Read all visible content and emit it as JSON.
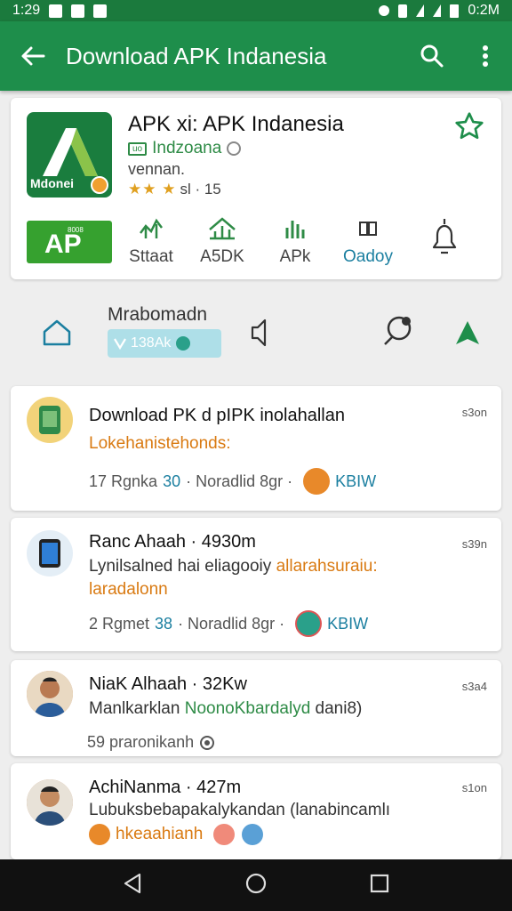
{
  "status_bar": {
    "time": "1:29",
    "clock": "0:2M"
  },
  "app_bar": {
    "title": "Download APK Indanesia"
  },
  "app_card": {
    "logo_text": "Mdonei",
    "name": "APK xi: APK Indanesia",
    "developer_badge": "uo",
    "developer": "Indzoana",
    "version": "vennan.",
    "stars": "★★ ★",
    "rating_text": "sl · 15",
    "ap_button_small": "8008",
    "ap_button_big": "AP",
    "features": [
      {
        "label": "Sttaat"
      },
      {
        "label": "A5DK"
      },
      {
        "label": "APk"
      },
      {
        "label": "Oadoy"
      }
    ]
  },
  "action_row": {
    "title": "Mrabomadn",
    "size_chip": "138Ak"
  },
  "posts": [
    {
      "title": "Download PK d pIPK inolahallan",
      "time": "s3on",
      "line1": "Lokehanistehonds:",
      "meta_pre": "17 Rgnka",
      "meta_num": "30",
      "meta_post": "· Noradlid 8gr ·",
      "tag": "KBIW"
    },
    {
      "title": "Ranc Ahaah · 4930m",
      "time": "s39n",
      "line1_dark": "Lynilsalned hai eliagooiy",
      "line1_orange": "allarahsuraiu:",
      "line2": "laradalonn",
      "meta_pre": "2 Rgmet",
      "meta_num": "38",
      "meta_post": "· Noradlid 8gr ·",
      "tag": "KBIW"
    },
    {
      "title": "NiaK Alhaah · 32Kw",
      "time": "s3a4",
      "line1_dark": "Manlkarklan",
      "line1_green": "NoonoKbardalyd",
      "line1_end": "dani8)",
      "meta": "59 praronikanh"
    },
    {
      "title": "AchiNanma · 427m",
      "time": "s1on",
      "line1": "Lubuksbebapakalykandan (lanabincamlı",
      "line2": "hkeaahianh"
    }
  ],
  "colors": {
    "status_bar": "#1b7a3d",
    "app_bar": "#1e8e4b",
    "accent_green": "#2e8b46",
    "accent_orange": "#d97a12",
    "accent_teal": "#1b7fa0"
  }
}
